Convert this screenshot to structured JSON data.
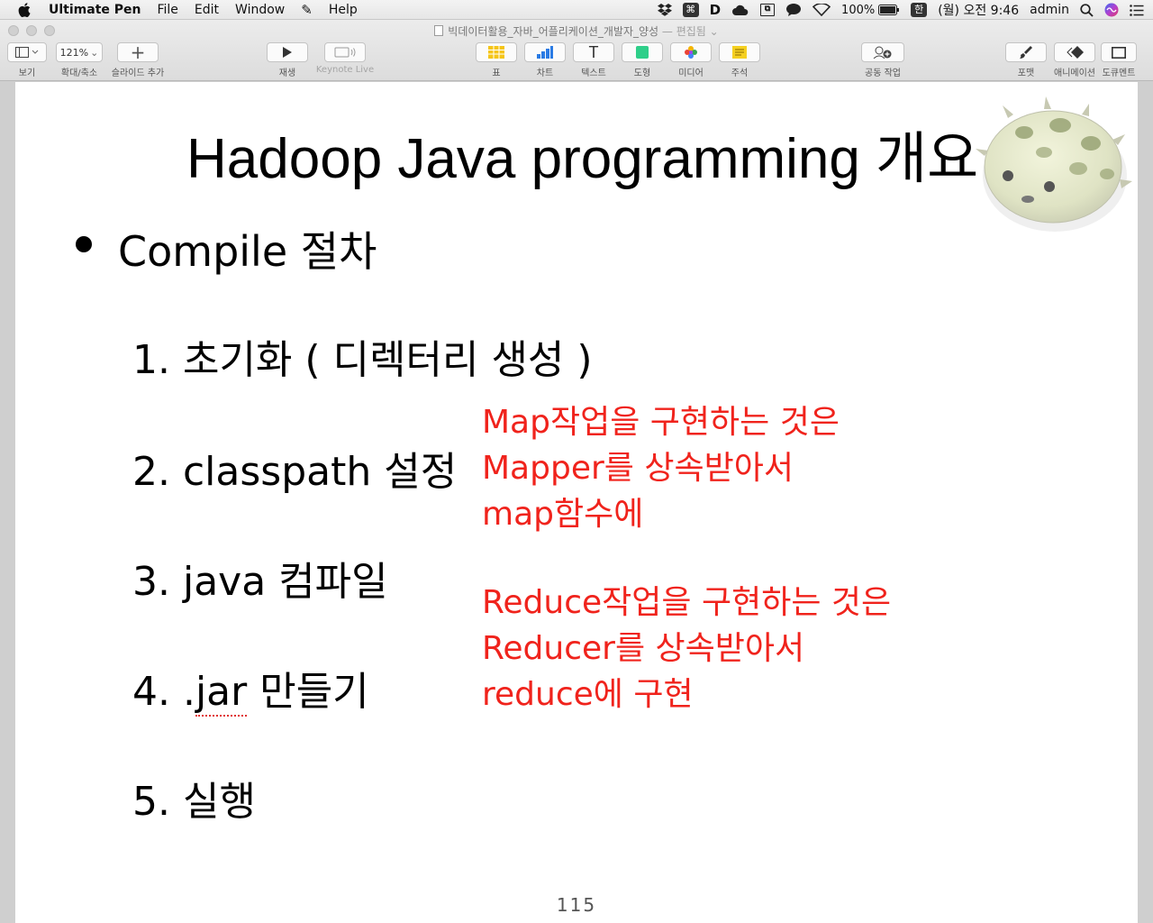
{
  "menubar": {
    "app_name": "Ultimate Pen",
    "items": [
      "File",
      "Edit",
      "Window",
      "Help"
    ],
    "battery": "100%",
    "ime": "한",
    "datetime": "(월) 오전 9:46",
    "user": "admin"
  },
  "window": {
    "title": "빅데이터활용_자바_어플리케이션_개발자_양성",
    "status": "— 편집됨"
  },
  "toolbar": {
    "view_label": "보기",
    "zoom_value": "121%",
    "zoom_label": "확대/축소",
    "add_slide_label": "슬라이드 추가",
    "play_label": "재생",
    "keynote_live_label": "Keynote Live",
    "table_label": "표",
    "chart_label": "차트",
    "text_label": "텍스트",
    "shape_label": "도형",
    "media_label": "미디어",
    "comment_label": "주석",
    "collab_label": "공동 작업",
    "format_label": "포맷",
    "animate_label": "애니메이션",
    "document_label": "도큐멘트"
  },
  "slide": {
    "title": "Hadoop Java programming 개요",
    "bullet": "Compile 절차",
    "steps": [
      "1. 초기화 ( 디렉터리 생성 )",
      "2. classpath 설정",
      "3. java 컴파일",
      "4. .jar 만들기",
      "5. 실행"
    ],
    "step4_prefix": "4. .",
    "step4_jar": "jar",
    "step4_suffix": " 만들기",
    "map_note": [
      "Map작업을 구현하는 것은",
      "Mapper를 상속받아서",
      "map함수에"
    ],
    "reduce_note": [
      "Reduce작업을 구현하는 것은",
      "Reducer를 상속받아서",
      "reduce에 구현"
    ],
    "page_number": "115"
  },
  "colors": {
    "note_red": "#f0231c",
    "title_black": "#000000"
  }
}
